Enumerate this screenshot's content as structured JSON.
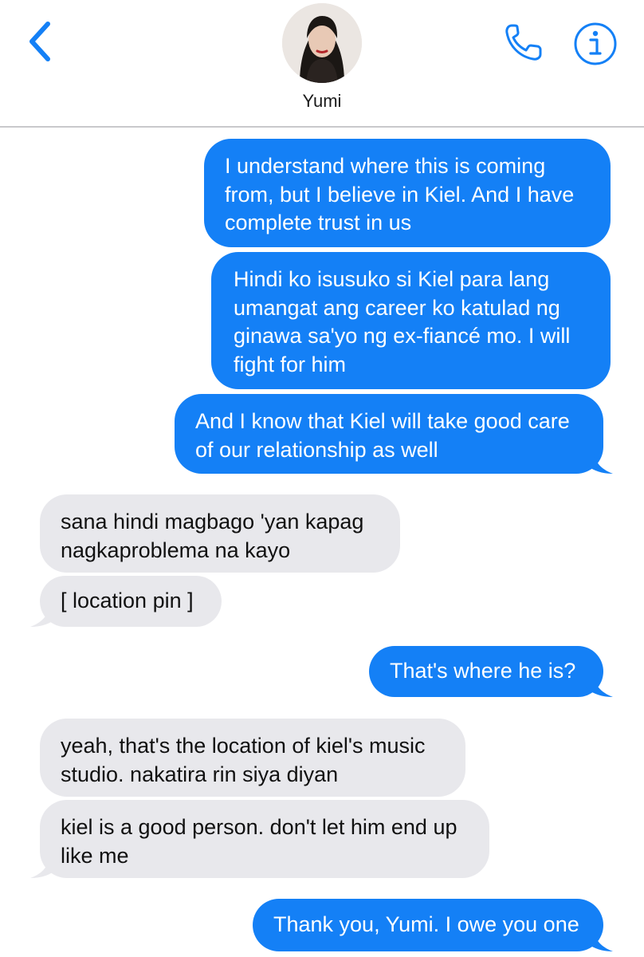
{
  "header": {
    "contact_name": "Yumi",
    "back_icon": "chevron-left-icon",
    "call_icon": "phone-icon",
    "info_icon": "info-icon",
    "accent_color": "#1480f6"
  },
  "messages": [
    {
      "from": "me",
      "text": "I understand where this is coming from, but I believe in Kiel. And I have complete trust in us"
    },
    {
      "from": "me",
      "text": "Hindi ko isusuko si Kiel para lang umangat ang career ko katulad ng ginawa sa'yo ng ex-fiancé mo. I will fight for him"
    },
    {
      "from": "me",
      "text": "And I know that Kiel will take good care of our relationship as well"
    },
    {
      "from": "yumi",
      "text": "sana hindi magbago 'yan kapag nagkaproblema na kayo"
    },
    {
      "from": "yumi",
      "text": "[ location pin ]"
    },
    {
      "from": "me",
      "text": "That's where he is?"
    },
    {
      "from": "yumi",
      "text": "yeah, that's the location of kiel's music studio. nakatira rin siya diyan"
    },
    {
      "from": "yumi",
      "text": "kiel is a good person. don't let him end up like me"
    },
    {
      "from": "me",
      "text": "Thank you, Yumi. I owe you one"
    }
  ],
  "colors": {
    "sent_bubble": "#1480f6",
    "received_bubble": "#e8e8ec"
  }
}
